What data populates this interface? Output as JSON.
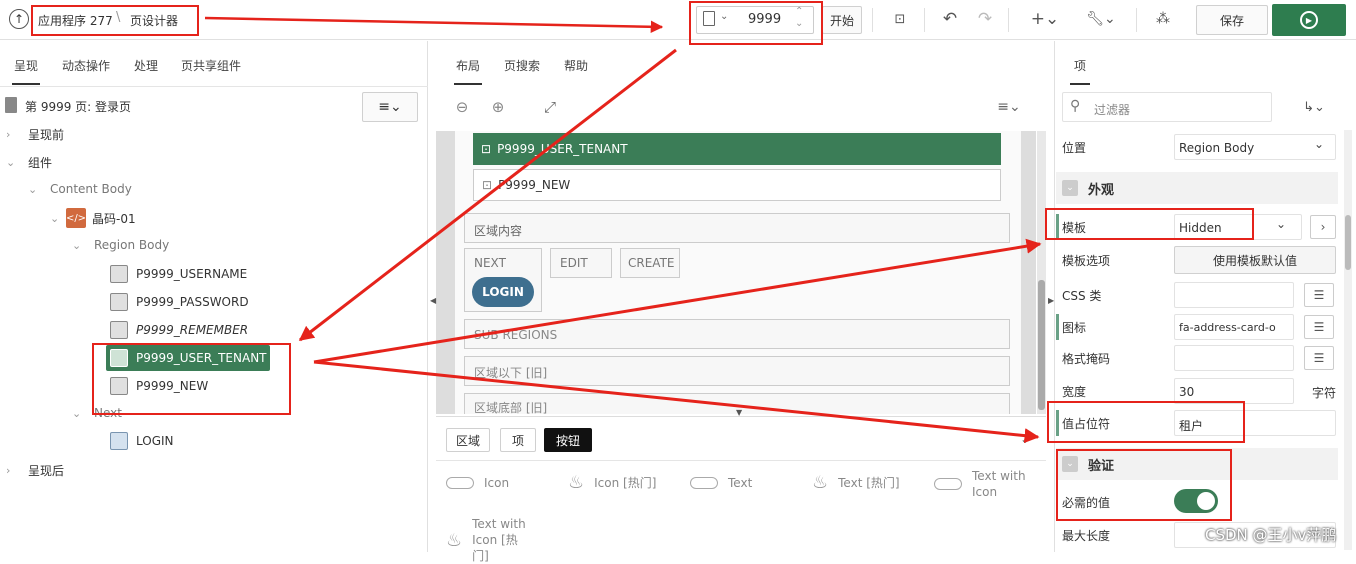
{
  "toolbar": {
    "app_label": "应用程序 277",
    "page_designer_label": "页设计器",
    "page_number": "9999",
    "go_label": "开始",
    "save_label": "保存"
  },
  "left_panel": {
    "tabs": [
      "呈现",
      "动态操作",
      "处理",
      "页共享组件"
    ],
    "page_title": "第 9999 页: 登录页",
    "tree": {
      "before": "呈现前",
      "components": "组件",
      "content_body": "Content Body",
      "region": "晶码-01",
      "region_body": "Region Body",
      "items": [
        "P9999_USERNAME",
        "P9999_PASSWORD",
        "P9999_REMEMBER",
        "P9999_USER_TENANT",
        "P9999_NEW"
      ],
      "next": "Next",
      "login_btn": "LOGIN",
      "after": "呈现后"
    }
  },
  "center": {
    "tabs": [
      "布局",
      "页搜索",
      "帮助"
    ],
    "item_tenant": "P9999_USER_TENANT",
    "item_new": "P9999_NEW",
    "region_content": "区域内容",
    "next": "NEXT",
    "edit": "EDIT",
    "create": "CREATE",
    "login": "LOGIN",
    "sub_regions": "SUB REGIONS",
    "below_region": "区域以下 [旧]",
    "region_bottom": "区域底部 [旧]",
    "gallery_tabs": [
      "区域",
      "项",
      "按钮"
    ],
    "gallery": [
      "Icon",
      "Icon [热门]",
      "Text",
      "Text [热门]",
      "Text with Icon",
      "Text with Icon [热门]"
    ]
  },
  "right_panel": {
    "tab": "项",
    "filter_placeholder": "过滤器",
    "position_label": "位置",
    "position_value": "Region Body",
    "appearance_header": "外观",
    "template_label": "模板",
    "template_value": "Hidden",
    "template_options_label": "模板选项",
    "use_default_label": "使用模板默认值",
    "css_label": "CSS 类",
    "icon_label": "图标",
    "icon_value": "fa-address-card-o",
    "format_mask_label": "格式掩码",
    "width_label": "宽度",
    "width_value": "30",
    "width_unit": "字符",
    "placeholder_label": "值占位符",
    "placeholder_value": "租户",
    "validation_header": "验证",
    "required_label": "必需的值",
    "max_length_label": "最大长度"
  },
  "watermark": "CSDN @王小v萍鹏",
  "colors": {
    "accent_green": "#3b7d57",
    "primary_green": "#2e7d4f",
    "red": "#e5231b"
  }
}
